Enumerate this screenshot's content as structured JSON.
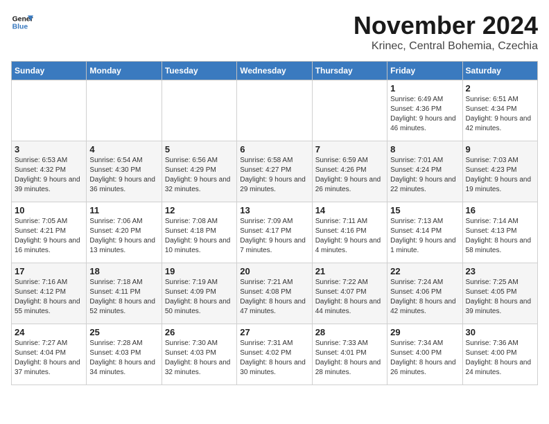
{
  "logo": {
    "line1": "General",
    "line2": "Blue"
  },
  "header": {
    "month": "November 2024",
    "location": "Krinec, Central Bohemia, Czechia"
  },
  "weekdays": [
    "Sunday",
    "Monday",
    "Tuesday",
    "Wednesday",
    "Thursday",
    "Friday",
    "Saturday"
  ],
  "weeks": [
    [
      {
        "day": "",
        "content": ""
      },
      {
        "day": "",
        "content": ""
      },
      {
        "day": "",
        "content": ""
      },
      {
        "day": "",
        "content": ""
      },
      {
        "day": "",
        "content": ""
      },
      {
        "day": "1",
        "content": "Sunrise: 6:49 AM\nSunset: 4:36 PM\nDaylight: 9 hours\nand 46 minutes."
      },
      {
        "day": "2",
        "content": "Sunrise: 6:51 AM\nSunset: 4:34 PM\nDaylight: 9 hours\nand 42 minutes."
      }
    ],
    [
      {
        "day": "3",
        "content": "Sunrise: 6:53 AM\nSunset: 4:32 PM\nDaylight: 9 hours\nand 39 minutes."
      },
      {
        "day": "4",
        "content": "Sunrise: 6:54 AM\nSunset: 4:30 PM\nDaylight: 9 hours\nand 36 minutes."
      },
      {
        "day": "5",
        "content": "Sunrise: 6:56 AM\nSunset: 4:29 PM\nDaylight: 9 hours\nand 32 minutes."
      },
      {
        "day": "6",
        "content": "Sunrise: 6:58 AM\nSunset: 4:27 PM\nDaylight: 9 hours\nand 29 minutes."
      },
      {
        "day": "7",
        "content": "Sunrise: 6:59 AM\nSunset: 4:26 PM\nDaylight: 9 hours\nand 26 minutes."
      },
      {
        "day": "8",
        "content": "Sunrise: 7:01 AM\nSunset: 4:24 PM\nDaylight: 9 hours\nand 22 minutes."
      },
      {
        "day": "9",
        "content": "Sunrise: 7:03 AM\nSunset: 4:23 PM\nDaylight: 9 hours\nand 19 minutes."
      }
    ],
    [
      {
        "day": "10",
        "content": "Sunrise: 7:05 AM\nSunset: 4:21 PM\nDaylight: 9 hours\nand 16 minutes."
      },
      {
        "day": "11",
        "content": "Sunrise: 7:06 AM\nSunset: 4:20 PM\nDaylight: 9 hours\nand 13 minutes."
      },
      {
        "day": "12",
        "content": "Sunrise: 7:08 AM\nSunset: 4:18 PM\nDaylight: 9 hours\nand 10 minutes."
      },
      {
        "day": "13",
        "content": "Sunrise: 7:09 AM\nSunset: 4:17 PM\nDaylight: 9 hours\nand 7 minutes."
      },
      {
        "day": "14",
        "content": "Sunrise: 7:11 AM\nSunset: 4:16 PM\nDaylight: 9 hours\nand 4 minutes."
      },
      {
        "day": "15",
        "content": "Sunrise: 7:13 AM\nSunset: 4:14 PM\nDaylight: 9 hours\nand 1 minute."
      },
      {
        "day": "16",
        "content": "Sunrise: 7:14 AM\nSunset: 4:13 PM\nDaylight: 8 hours\nand 58 minutes."
      }
    ],
    [
      {
        "day": "17",
        "content": "Sunrise: 7:16 AM\nSunset: 4:12 PM\nDaylight: 8 hours\nand 55 minutes."
      },
      {
        "day": "18",
        "content": "Sunrise: 7:18 AM\nSunset: 4:11 PM\nDaylight: 8 hours\nand 52 minutes."
      },
      {
        "day": "19",
        "content": "Sunrise: 7:19 AM\nSunset: 4:09 PM\nDaylight: 8 hours\nand 50 minutes."
      },
      {
        "day": "20",
        "content": "Sunrise: 7:21 AM\nSunset: 4:08 PM\nDaylight: 8 hours\nand 47 minutes."
      },
      {
        "day": "21",
        "content": "Sunrise: 7:22 AM\nSunset: 4:07 PM\nDaylight: 8 hours\nand 44 minutes."
      },
      {
        "day": "22",
        "content": "Sunrise: 7:24 AM\nSunset: 4:06 PM\nDaylight: 8 hours\nand 42 minutes."
      },
      {
        "day": "23",
        "content": "Sunrise: 7:25 AM\nSunset: 4:05 PM\nDaylight: 8 hours\nand 39 minutes."
      }
    ],
    [
      {
        "day": "24",
        "content": "Sunrise: 7:27 AM\nSunset: 4:04 PM\nDaylight: 8 hours\nand 37 minutes."
      },
      {
        "day": "25",
        "content": "Sunrise: 7:28 AM\nSunset: 4:03 PM\nDaylight: 8 hours\nand 34 minutes."
      },
      {
        "day": "26",
        "content": "Sunrise: 7:30 AM\nSunset: 4:03 PM\nDaylight: 8 hours\nand 32 minutes."
      },
      {
        "day": "27",
        "content": "Sunrise: 7:31 AM\nSunset: 4:02 PM\nDaylight: 8 hours\nand 30 minutes."
      },
      {
        "day": "28",
        "content": "Sunrise: 7:33 AM\nSunset: 4:01 PM\nDaylight: 8 hours\nand 28 minutes."
      },
      {
        "day": "29",
        "content": "Sunrise: 7:34 AM\nSunset: 4:00 PM\nDaylight: 8 hours\nand 26 minutes."
      },
      {
        "day": "30",
        "content": "Sunrise: 7:36 AM\nSunset: 4:00 PM\nDaylight: 8 hours\nand 24 minutes."
      }
    ]
  ]
}
